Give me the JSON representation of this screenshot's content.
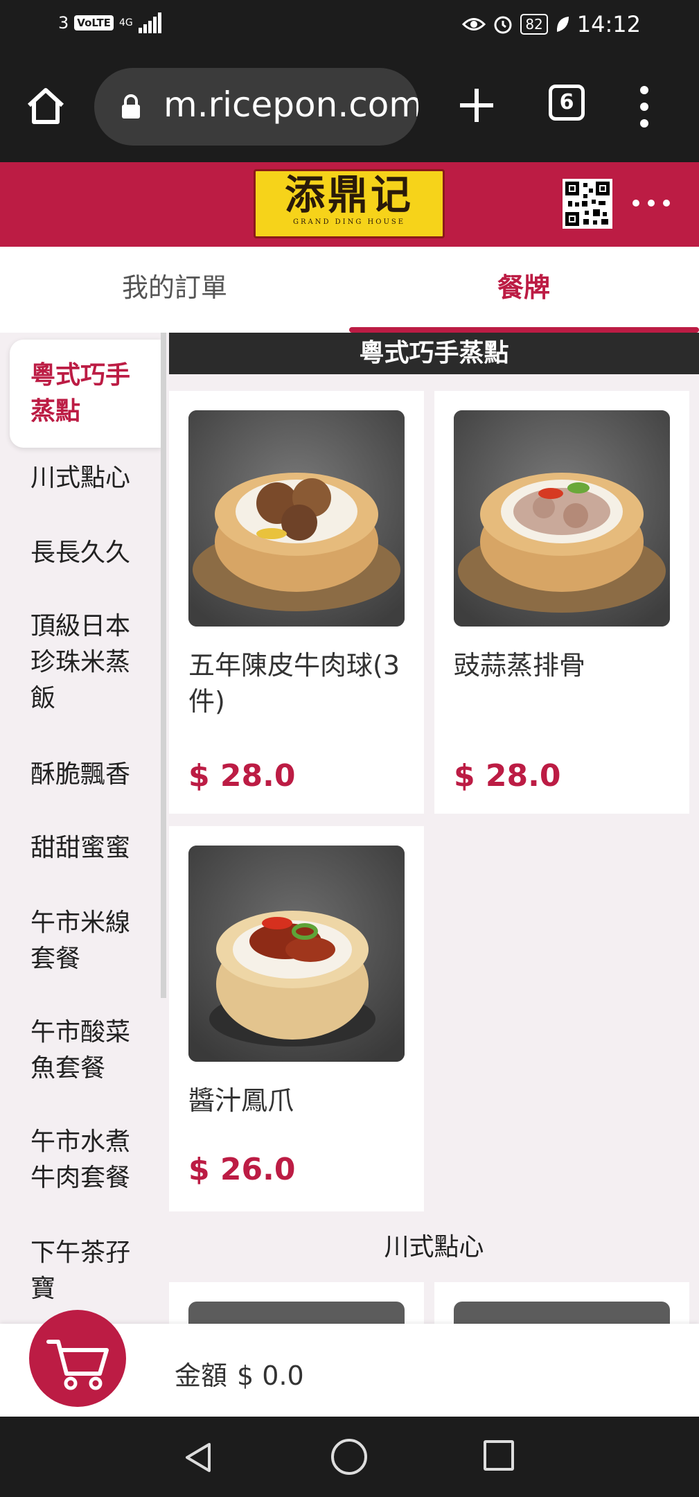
{
  "status_bar": {
    "sim_slot": "3",
    "volte": "VoLTE",
    "network": "4G",
    "battery": "82",
    "time": "14:12"
  },
  "browser": {
    "url": "m.ricepon.com/",
    "tab_count": "6"
  },
  "header": {
    "logo_name": "添鼎记",
    "logo_subtitle": "GRAND DING HOUSE"
  },
  "tabs": [
    {
      "label": "我的訂單",
      "active": false
    },
    {
      "label": "餐牌",
      "active": true
    }
  ],
  "categories": [
    {
      "label": "粵式巧手蒸點",
      "active": true
    },
    {
      "label": "川式點心",
      "active": false
    },
    {
      "label": "長長久久",
      "active": false
    },
    {
      "label": "頂級日本珍珠米蒸飯",
      "active": false
    },
    {
      "label": "酥脆飄香",
      "active": false
    },
    {
      "label": "甜甜蜜蜜",
      "active": false
    },
    {
      "label": "午市米線套餐",
      "active": false
    },
    {
      "label": "午市酸菜魚套餐",
      "active": false
    },
    {
      "label": "午市水煮牛肉套餐",
      "active": false
    },
    {
      "label": "下午茶孖寶",
      "active": false
    }
  ],
  "menu": {
    "section_title": "粵式巧手蒸點",
    "items": [
      {
        "name": "五年陳皮牛肉球(3件)",
        "price": "$ 28.0"
      },
      {
        "name": "豉蒜蒸排骨",
        "price": "$ 28.0"
      },
      {
        "name": "醬汁鳳爪",
        "price": "$ 26.0"
      }
    ],
    "next_section_title": "川式點心"
  },
  "cart": {
    "amount_label": "金額",
    "amount_value": "$ 0.0"
  }
}
